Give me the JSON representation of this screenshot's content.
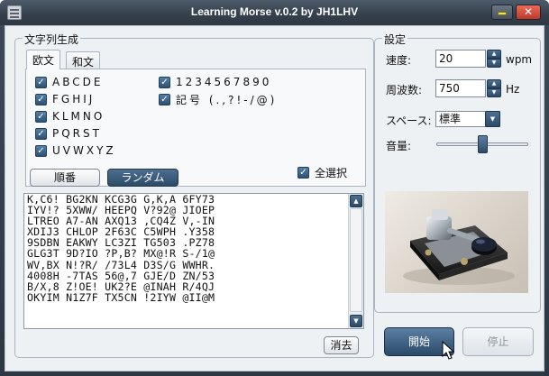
{
  "window": {
    "title": "Learning Morse v.0.2 by JH1LHV"
  },
  "generator": {
    "group_title": "文字列生成",
    "tabs": [
      {
        "label": "欧文"
      },
      {
        "label": "和文"
      }
    ],
    "checkboxes": [
      {
        "label": "ABCDE",
        "checked": true
      },
      {
        "label": "FGHIJ",
        "checked": true
      },
      {
        "label": "KLMNO",
        "checked": true
      },
      {
        "label": "PQRST",
        "checked": true
      },
      {
        "label": "UVWXYZ",
        "checked": true
      },
      {
        "label": "1234567890",
        "checked": true
      },
      {
        "label": "記号 (.,?!-/@)",
        "checked": true
      }
    ],
    "select_all": {
      "label": "全選択",
      "checked": true
    },
    "order_buttons": [
      {
        "label": "順番",
        "selected": false
      },
      {
        "label": "ランダム",
        "selected": true
      }
    ],
    "output_lines": [
      "K,C6! BG2KN KCG3G G,K,A 6FY73",
      "IYV!? 5XWW/ HEEPQ V?92@ JIOEP",
      "LTREO A7-AN AXQ13 ,CQ4Z V,-IN",
      "XDIJ3 CHLOP 2F63C C5WPH .Y358",
      "9SDBN EAKWY LC3ZI TG503 .PZ78",
      "GLG3T 9D?IO ?P,B? MX@!R S-/1@",
      "WV,BX N!?R/ /73L4 D3S/G WWHR.",
      "4008H -7TAS 56@,7 GJE/D ZN/53",
      "B/X,8 Z!OE! UK2?E @INAH R/4QJ",
      "OKYIM N1Z7F TX5CN !2IYW @II@M"
    ],
    "clear_label": "消去"
  },
  "settings": {
    "group_title": "設定",
    "speed": {
      "label": "速度:",
      "value": "20",
      "unit": "wpm"
    },
    "frequency": {
      "label": "周波数:",
      "value": "750",
      "unit": "Hz"
    },
    "space": {
      "label": "スペース:",
      "value": "標準"
    },
    "volume": {
      "label": "音量:",
      "level_fraction": 0.5
    }
  },
  "actions": {
    "start_label": "開始",
    "stop_label": "停止",
    "stop_enabled": false
  },
  "colors": {
    "accent_dark": "#2c4b69",
    "titlebar": "#36414d",
    "client_bg": "#eef1f4"
  }
}
